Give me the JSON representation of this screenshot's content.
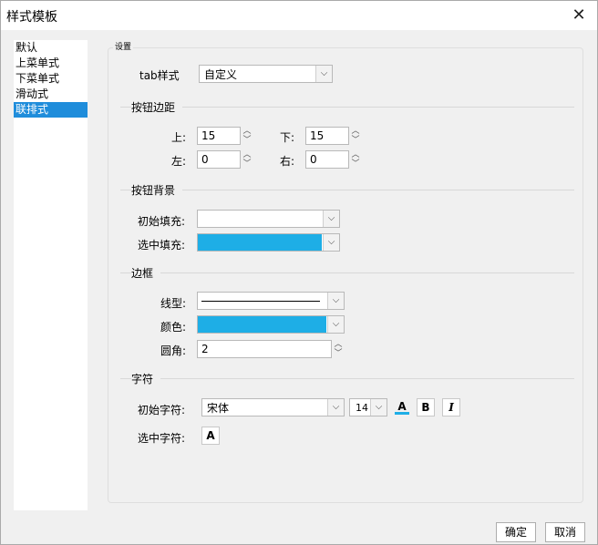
{
  "window": {
    "title": "样式模板"
  },
  "sidebar": {
    "items": [
      {
        "label": "默认"
      },
      {
        "label": "上菜单式"
      },
      {
        "label": "下菜单式"
      },
      {
        "label": "滑动式"
      },
      {
        "label": "联排式"
      }
    ]
  },
  "panel": {
    "label": "设置"
  },
  "tab_style": {
    "label": "tab样式",
    "value": "自定义"
  },
  "margin": {
    "title": "按钮边距",
    "top_label": "上:",
    "top_value": "15",
    "bottom_label": "下:",
    "bottom_value": "15",
    "left_label": "左:",
    "left_value": "0",
    "right_label": "右:",
    "right_value": "0"
  },
  "background": {
    "title": "按钮背景",
    "initial_label": "初始填充:",
    "selected_label": "选中填充:",
    "initial_color": "#ffffff",
    "selected_color": "#1eaee6"
  },
  "border": {
    "title": "边框",
    "line_label": "线型:",
    "color_label": "颜色:",
    "color_value": "#1eaee6",
    "radius_label": "圆角:",
    "radius_value": "2"
  },
  "font": {
    "title": "字符",
    "initial_label": "初始字符:",
    "family": "宋体",
    "size": "14",
    "color_glyph": "A",
    "bold_glyph": "B",
    "italic_glyph": "I",
    "underline_color": "#1eaee6",
    "selected_label": "选中字符:",
    "selected_glyph": "A"
  },
  "footer": {
    "ok": "确定",
    "cancel": "取消"
  }
}
